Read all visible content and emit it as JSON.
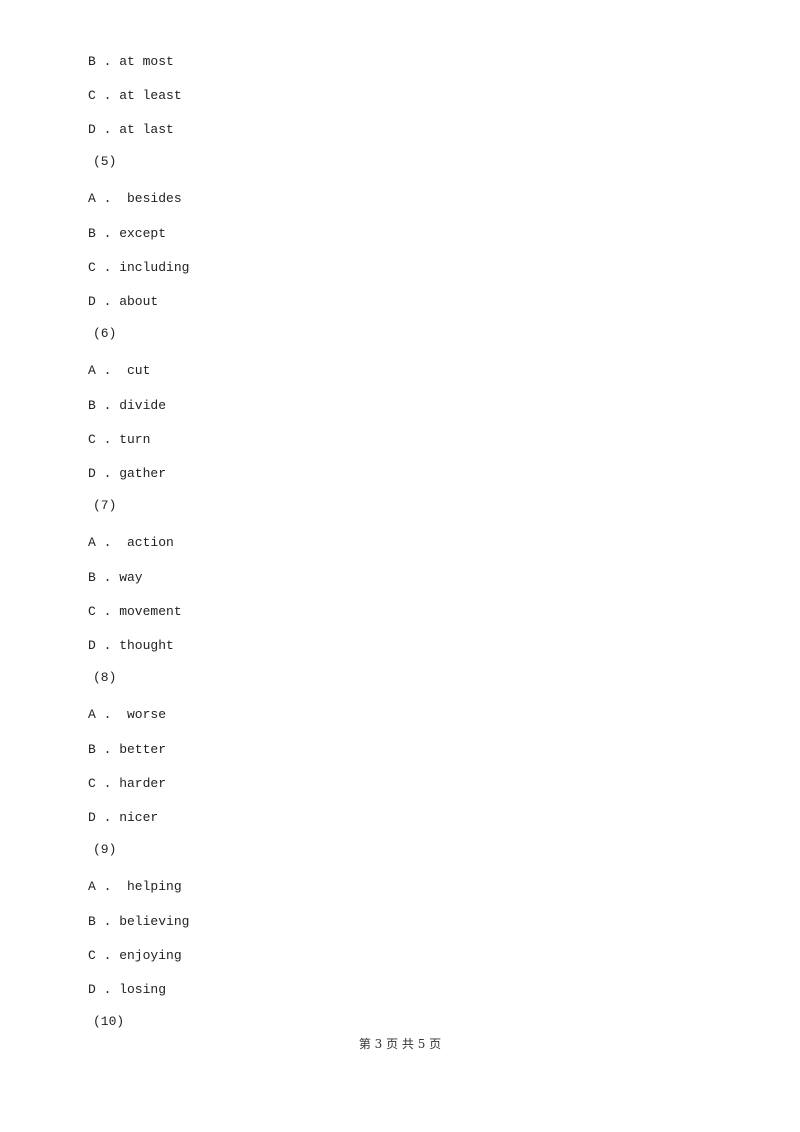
{
  "lines": [
    {
      "type": "option",
      "text": "B . at most"
    },
    {
      "type": "option",
      "text": "C . at least"
    },
    {
      "type": "option",
      "text": "D . at last"
    },
    {
      "type": "question",
      "text": "(5)"
    },
    {
      "type": "option",
      "text": "A .  besides"
    },
    {
      "type": "option",
      "text": "B . except"
    },
    {
      "type": "option",
      "text": "C . including"
    },
    {
      "type": "option",
      "text": "D . about"
    },
    {
      "type": "question",
      "text": "(6)"
    },
    {
      "type": "option",
      "text": "A .  cut"
    },
    {
      "type": "option",
      "text": "B . divide"
    },
    {
      "type": "option",
      "text": "C . turn"
    },
    {
      "type": "option",
      "text": "D . gather"
    },
    {
      "type": "question",
      "text": "(7)"
    },
    {
      "type": "option",
      "text": "A .  action"
    },
    {
      "type": "option",
      "text": "B . way"
    },
    {
      "type": "option",
      "text": "C . movement"
    },
    {
      "type": "option",
      "text": "D . thought"
    },
    {
      "type": "question",
      "text": "(8)"
    },
    {
      "type": "option",
      "text": "A .  worse"
    },
    {
      "type": "option",
      "text": "B . better"
    },
    {
      "type": "option",
      "text": "C . harder"
    },
    {
      "type": "option",
      "text": "D . nicer"
    },
    {
      "type": "question",
      "text": "(9)"
    },
    {
      "type": "option",
      "text": "A .  helping"
    },
    {
      "type": "option",
      "text": "B . believing"
    },
    {
      "type": "option",
      "text": "C . enjoying"
    },
    {
      "type": "option",
      "text": "D . losing"
    },
    {
      "type": "question",
      "text": "(10)"
    }
  ],
  "footer": "第 3 页 共 5 页"
}
